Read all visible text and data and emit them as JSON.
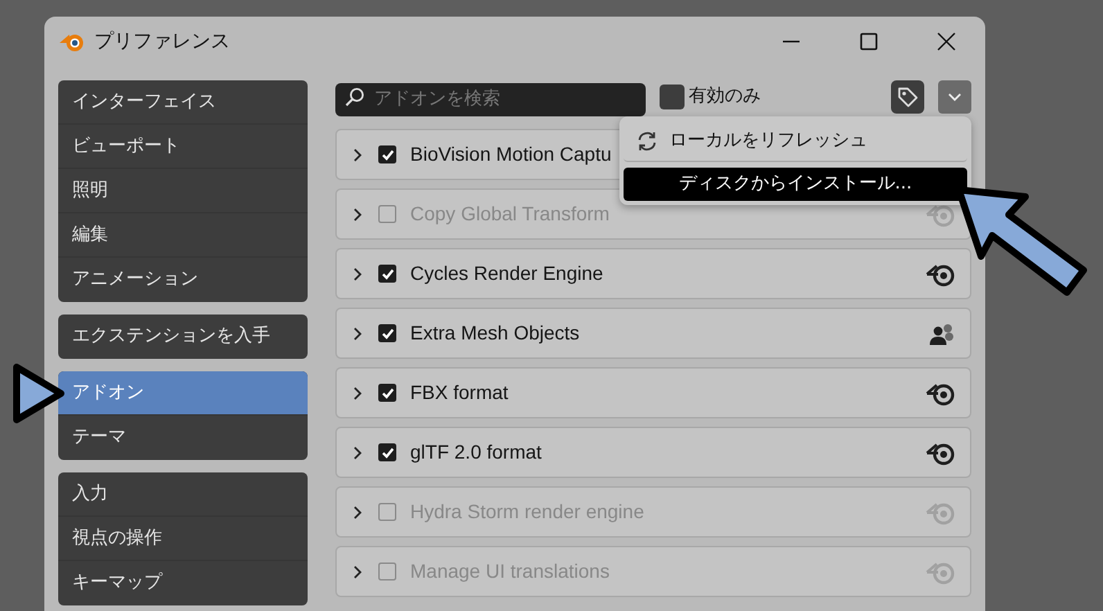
{
  "window": {
    "title": "プリファレンス"
  },
  "sidebar": {
    "groups": [
      {
        "items": [
          {
            "label": "インターフェイス",
            "selected": false
          },
          {
            "label": "ビューポート",
            "selected": false
          },
          {
            "label": "照明",
            "selected": false
          },
          {
            "label": "編集",
            "selected": false
          },
          {
            "label": "アニメーション",
            "selected": false
          }
        ]
      },
      {
        "items": [
          {
            "label": "エクステンションを入手",
            "selected": false
          }
        ]
      },
      {
        "items": [
          {
            "label": "アドオン",
            "selected": true
          },
          {
            "label": "テーマ",
            "selected": false
          }
        ]
      },
      {
        "items": [
          {
            "label": "入力",
            "selected": false
          },
          {
            "label": "視点の操作",
            "selected": false
          },
          {
            "label": "キーマップ",
            "selected": false
          }
        ]
      }
    ]
  },
  "search": {
    "placeholder": "アドオンを検索"
  },
  "enabled_only": {
    "label": "有効のみ",
    "checked": false
  },
  "addons": [
    {
      "name": "BioVision Motion Captu",
      "checked": true
    },
    {
      "name": "Copy Global Transform",
      "checked": false,
      "kind": "official"
    },
    {
      "name": "Cycles Render Engine",
      "checked": true,
      "kind": "official"
    },
    {
      "name": "Extra Mesh Objects",
      "checked": true,
      "kind": "community"
    },
    {
      "name": "FBX format",
      "checked": true,
      "kind": "official"
    },
    {
      "name": "glTF 2.0 format",
      "checked": true,
      "kind": "official"
    },
    {
      "name": "Hydra Storm render engine",
      "checked": false,
      "kind": "official"
    },
    {
      "name": "Manage UI translations",
      "checked": false,
      "kind": "official"
    }
  ],
  "menu": {
    "items": [
      {
        "label": "ローカルをリフレッシュ",
        "selected": false
      },
      {
        "label": "ディスクからインストール...",
        "selected": true
      }
    ]
  }
}
